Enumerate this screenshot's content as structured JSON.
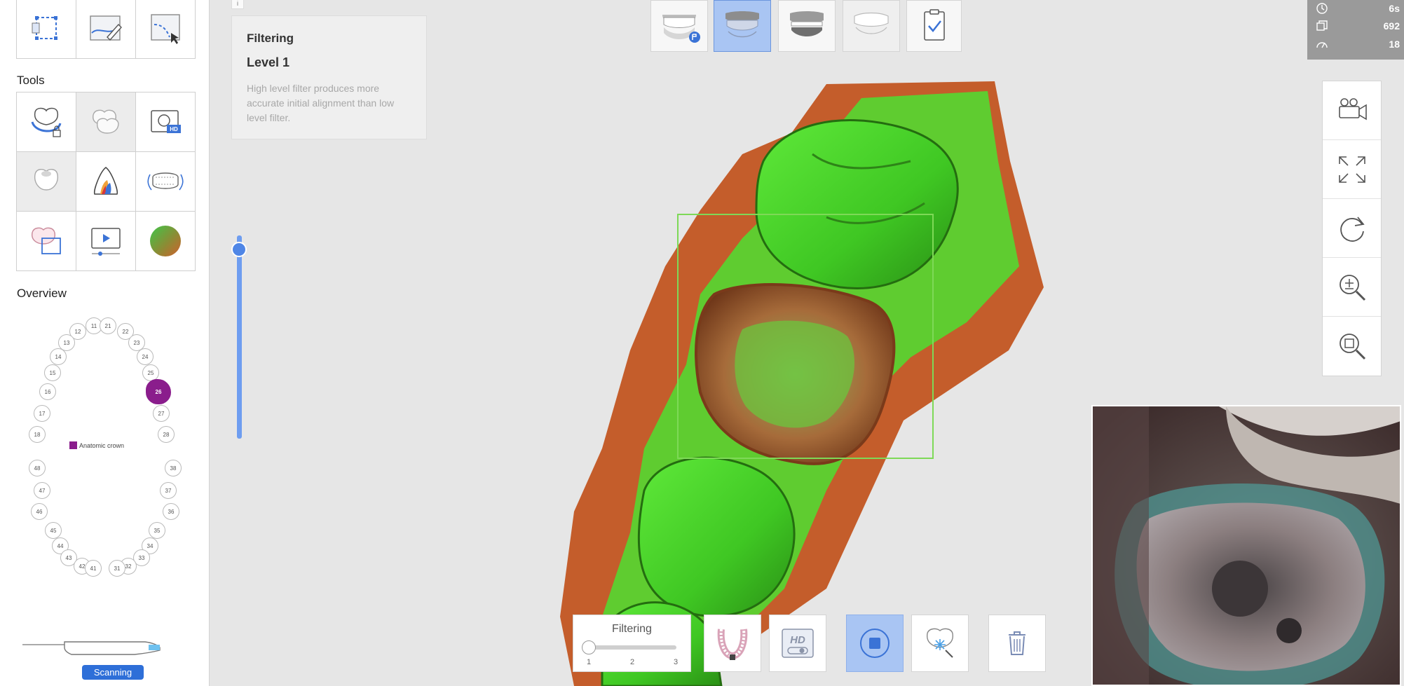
{
  "left_panel": {
    "tools_label": "Tools",
    "overview_label": "Overview",
    "legend_label": "Anatomic crown",
    "scan_status": "Scanning",
    "upper_teeth": [
      "11",
      "12",
      "13",
      "14",
      "15",
      "16",
      "17",
      "18",
      "21",
      "22",
      "23",
      "24",
      "25",
      "26",
      "27",
      "28"
    ],
    "lower_teeth": [
      "48",
      "47",
      "46",
      "45",
      "44",
      "43",
      "42",
      "41",
      "31",
      "32",
      "33",
      "34",
      "35",
      "36",
      "37",
      "38"
    ],
    "selected_tooth": "26",
    "selected_color": "#8a1d8c"
  },
  "info_panel": {
    "tab_text": "i",
    "title": "Filtering",
    "level": "Level 1",
    "description": "High level filter produces more accurate initial alignment than low level filter."
  },
  "stats": {
    "time": "6s",
    "count": "692",
    "speed": "18"
  },
  "bottom_toolbar": {
    "filter_label": "Filtering",
    "filter_ticks": [
      "1",
      "2",
      "3"
    ],
    "filter_value": 1,
    "hd_label": "HD"
  },
  "colors": {
    "accent": "#2e6fd8",
    "active_button": "#a9c5f3",
    "scan_green": "#4ee02c",
    "scan_orange": "#c05a2a"
  }
}
